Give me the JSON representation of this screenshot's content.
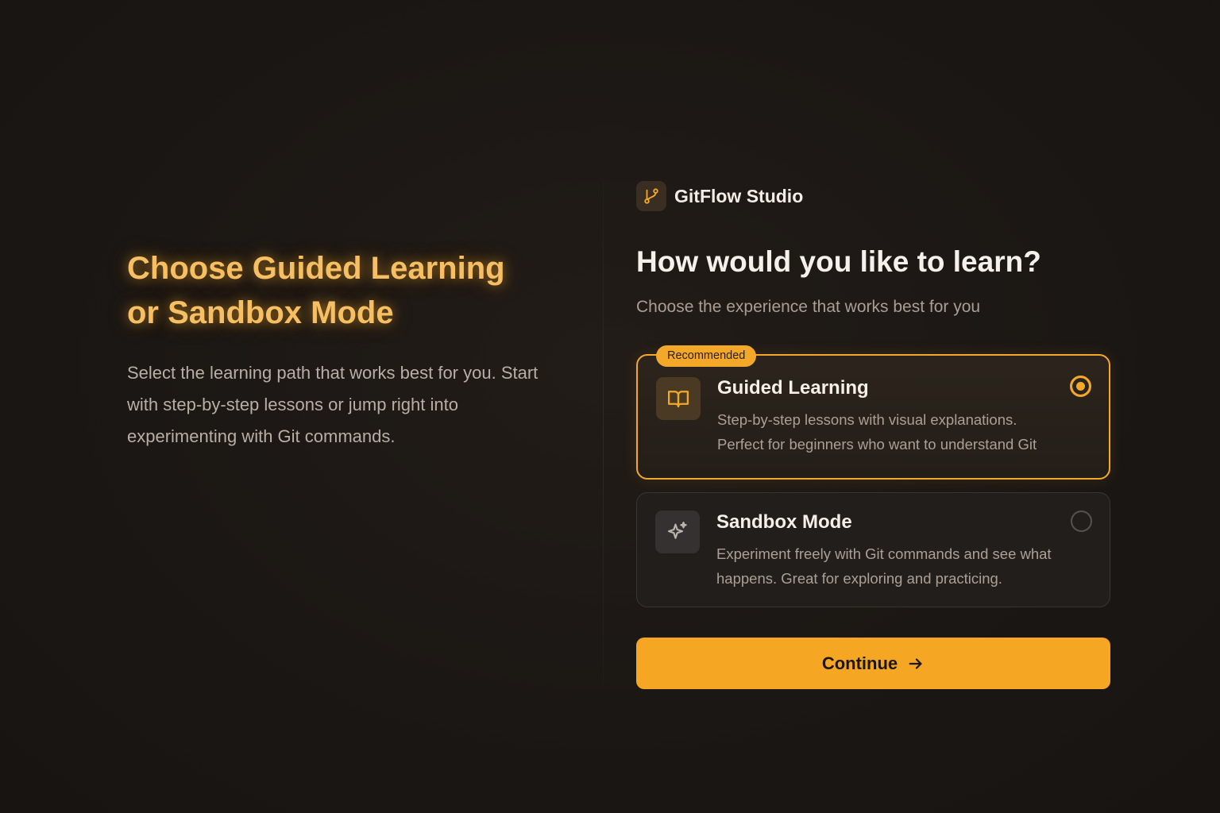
{
  "hero": {
    "title_line1": "Choose Guided Learning",
    "title_line2": "or Sandbox Mode",
    "description": "Select the learning path that works best for you. Start with step-by-step lessons or jump right into experimenting with Git commands."
  },
  "brand": {
    "name": "GitFlow Studio",
    "icon": "git-branch-icon"
  },
  "question": "How would you like to learn?",
  "subtitle": "Choose the experience that works best for you",
  "options": [
    {
      "badge": "Recommended",
      "title": "Guided Learning",
      "desc_line1": "Step-by-step lessons with visual explanations.",
      "desc_line2": "Perfect for beginners who want to understand Git",
      "icon": "book-icon",
      "selected": true
    },
    {
      "title": "Sandbox Mode",
      "desc_line1": "Experiment freely with Git commands and see what",
      "desc_line2": "happens. Great for exploring and practicing.",
      "icon": "sparkle-icon",
      "selected": false
    }
  ],
  "continue_label": "Continue",
  "colors": {
    "accent": "#f5a623",
    "background": "#1b1715",
    "card_selected_border": "#f4a829"
  }
}
